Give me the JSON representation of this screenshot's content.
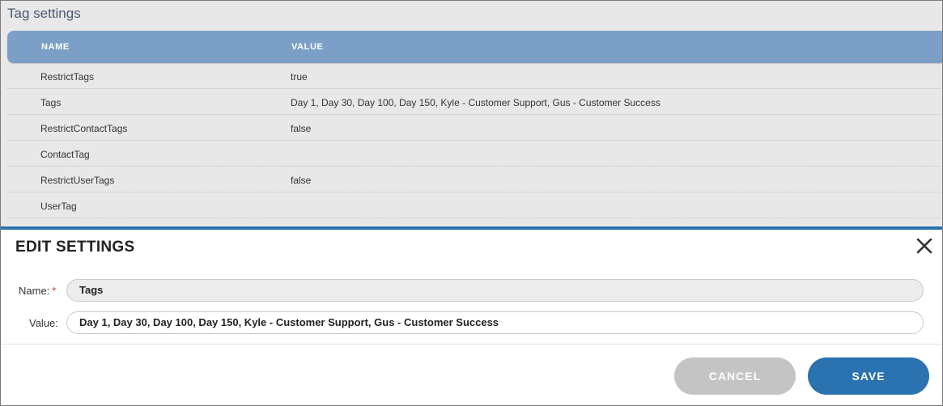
{
  "section": {
    "title": "Tag settings"
  },
  "table": {
    "headers": {
      "name": "NAME",
      "value": "VALUE"
    },
    "rows": [
      {
        "name": "RestrictTags",
        "value": "true"
      },
      {
        "name": "Tags",
        "value": "Day 1, Day 30, Day 100, Day 150, Kyle - Customer Support, Gus - Customer Success"
      },
      {
        "name": "RestrictContactTags",
        "value": "false"
      },
      {
        "name": "ContactTag",
        "value": ""
      },
      {
        "name": "RestrictUserTags",
        "value": "false"
      },
      {
        "name": "UserTag",
        "value": ""
      }
    ]
  },
  "modal": {
    "title": "EDIT SETTINGS",
    "close_icon": "close-icon",
    "name_label": "Name:",
    "required_mark": "*",
    "name_value": "Tags",
    "value_label": "Value:",
    "value_value": "Day 1, Day 30, Day 100, Day 150, Kyle - Customer Support, Gus - Customer Success",
    "cancel_label": "CANCEL",
    "save_label": "SAVE"
  },
  "colors": {
    "header_bg": "#7b9fc6",
    "accent": "#2a72b0",
    "cancel_bg": "#c4c4c4",
    "required": "#d33a2c"
  }
}
